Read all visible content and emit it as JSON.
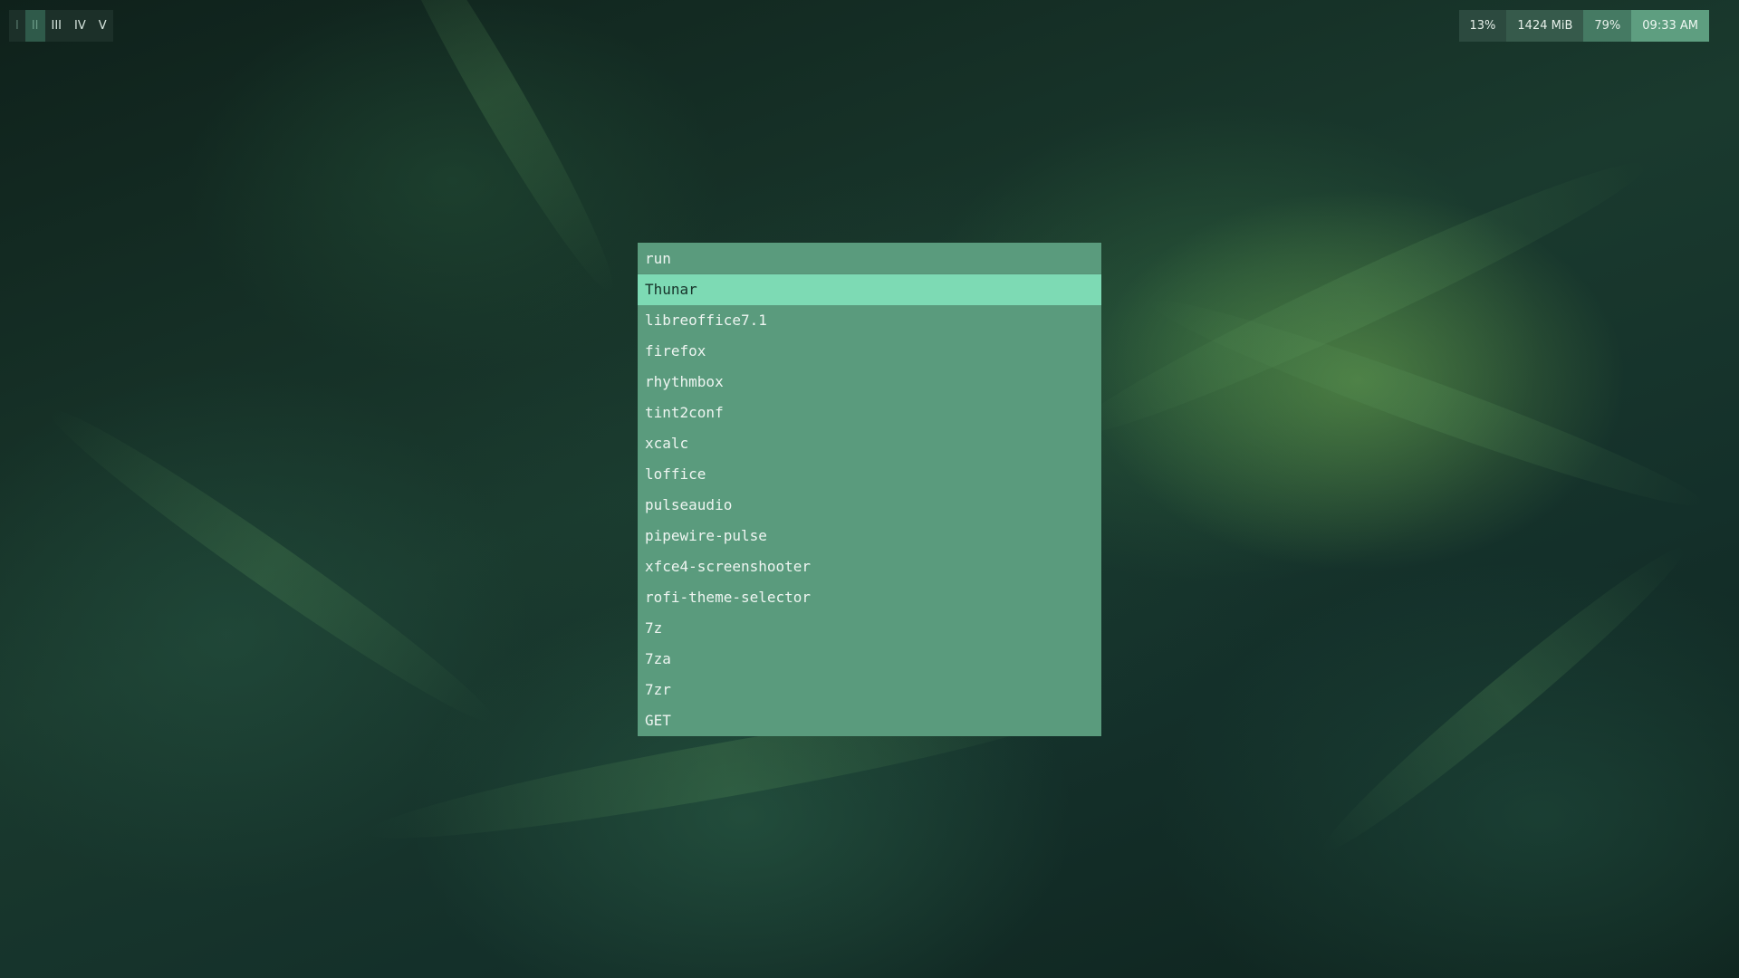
{
  "workspaces": [
    {
      "label": "I",
      "state": "dim"
    },
    {
      "label": "II",
      "state": "active"
    },
    {
      "label": "III",
      "state": "normal"
    },
    {
      "label": "IV",
      "state": "normal"
    },
    {
      "label": "V",
      "state": "normal"
    }
  ],
  "status": {
    "cpu": "13%",
    "memory": "1424 MiB",
    "battery": "79%",
    "clock": "09:33 AM"
  },
  "launcher": {
    "prompt": "run",
    "input_value": "",
    "selected_index": 0,
    "items": [
      "Thunar",
      "libreoffice7.1",
      "firefox",
      "rhythmbox",
      "tint2conf",
      "xcalc",
      "loffice",
      "pulseaudio",
      "pipewire-pulse",
      "xfce4-screenshooter",
      "rofi-theme-selector",
      "7z",
      "7za",
      "7zr",
      "GET"
    ]
  },
  "colors": {
    "launcher_bg": "#5a9b7d",
    "launcher_selected": "#7ddab4",
    "clock_bg": "#5e9e80"
  }
}
